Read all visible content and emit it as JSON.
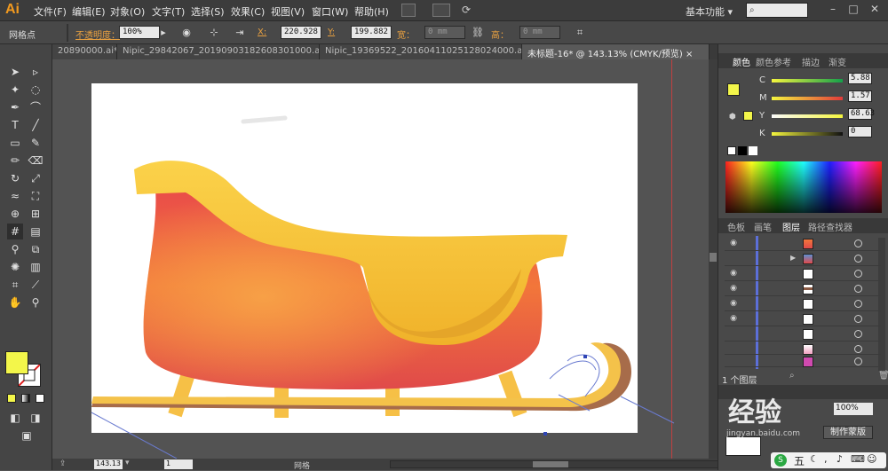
{
  "menubar": {
    "logo": "Ai",
    "items": [
      "文件(F)",
      "编辑(E)",
      "对象(O)",
      "文字(T)",
      "选择(S)",
      "效果(C)",
      "视图(V)",
      "窗口(W)",
      "帮助(H)"
    ],
    "workspace": "基本功能",
    "workspace_arrow": "▾"
  },
  "controlbar": {
    "selection_label": "网格点",
    "opacity_label": "不透明度：",
    "opacity_value": "100%",
    "x_label": "X:",
    "x_value": "220.928",
    "y_label": "Y:",
    "y_value": "199.882",
    "w_label": "宽：",
    "w_value": "0 mm",
    "h_label": "高：",
    "h_value": "0 mm"
  },
  "tabs": [
    {
      "label": "20890000.ai*",
      "close": "×"
    },
    {
      "label": "Nipic_29842067_20190903182608301000.ai*",
      "close": "×"
    },
    {
      "label": "Nipic_19369522_20160411025128024000.ai*",
      "close": "×"
    },
    {
      "label": "未标题-16* @ 143.13% (CMYK/预览)",
      "close": "×"
    }
  ],
  "color_panel": {
    "tabs": [
      "颜色",
      "颜色参考",
      "描边",
      "渐变"
    ],
    "channels": [
      {
        "name": "C",
        "value": "5.88"
      },
      {
        "name": "M",
        "value": "1.57"
      },
      {
        "name": "Y",
        "value": "68.63"
      },
      {
        "name": "K",
        "value": "0"
      }
    ],
    "fill_color": "#f3f64a"
  },
  "layers_panel": {
    "tabs": [
      "色板",
      "画笔",
      "图层",
      "路径查找器"
    ],
    "footer": "1 个图层",
    "rows": [
      {
        "visible": true,
        "expand": false,
        "thumb": "sleigh"
      },
      {
        "visible": false,
        "expand": true,
        "thumb": "group"
      },
      {
        "visible": true,
        "expand": false,
        "thumb": "brown"
      },
      {
        "visible": true,
        "expand": false,
        "thumb": "red"
      },
      {
        "visible": true,
        "expand": false,
        "thumb": "white"
      },
      {
        "visible": true,
        "expand": false,
        "thumb": "white"
      },
      {
        "visible": false,
        "expand": false,
        "thumb": "white"
      },
      {
        "visible": false,
        "expand": false,
        "thumb": "pink"
      },
      {
        "visible": false,
        "expand": false,
        "thumb": "magenta"
      }
    ]
  },
  "bottom_panel": {
    "opacity_value": "100%",
    "make_mask": "制作蒙版"
  },
  "statusbar": {
    "zoom": "143.13",
    "page": "1",
    "tool_name": "网格"
  },
  "watermark": {
    "text": "经验",
    "sub": "jingyan.baidu.com"
  },
  "ime": {
    "label": "五"
  }
}
